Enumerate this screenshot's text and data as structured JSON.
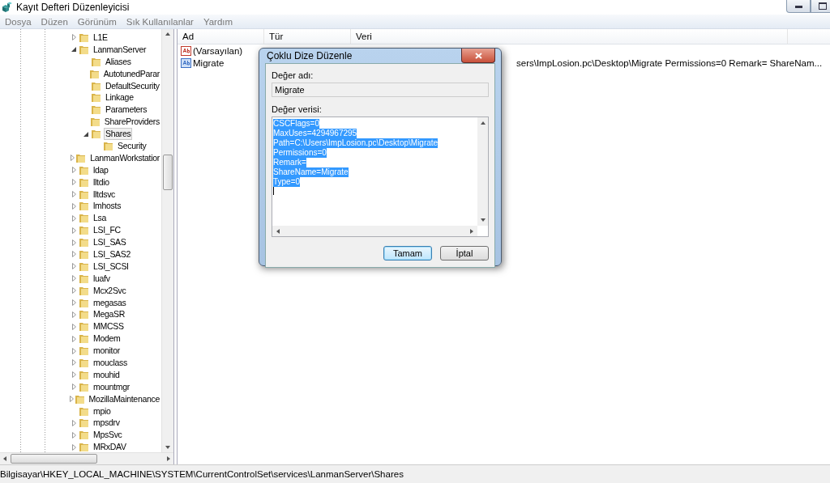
{
  "window": {
    "title": "Kayıt Defteri Düzenleyicisi"
  },
  "menu": [
    "Dosya",
    "Düzen",
    "Görünüm",
    "Sık Kullanılanlar",
    "Yardım"
  ],
  "tree": [
    {
      "label": "L1E",
      "kind": "branch",
      "expanded": false,
      "selected": false
    },
    {
      "label": "LanmanServer",
      "kind": "branch",
      "expanded": true,
      "selected": false,
      "children": [
        {
          "label": "Aliases",
          "kind": "leaf",
          "selected": false
        },
        {
          "label": "AutotunedParar",
          "kind": "leaf",
          "selected": false
        },
        {
          "label": "DefaultSecurity",
          "kind": "leaf",
          "selected": false
        },
        {
          "label": "Linkage",
          "kind": "leaf",
          "selected": false
        },
        {
          "label": "Parameters",
          "kind": "leaf",
          "selected": false
        },
        {
          "label": "ShareProviders",
          "kind": "leaf",
          "selected": false
        },
        {
          "label": "Shares",
          "kind": "branch",
          "expanded": true,
          "selected": true,
          "children": [
            {
              "label": "Security",
              "kind": "leaf",
              "selected": false
            }
          ]
        }
      ]
    },
    {
      "label": "LanmanWorkstatior",
      "kind": "branch",
      "expanded": false,
      "selected": false
    },
    {
      "label": "ldap",
      "kind": "branch",
      "expanded": false,
      "selected": false
    },
    {
      "label": "lltdio",
      "kind": "branch",
      "expanded": false,
      "selected": false
    },
    {
      "label": "lltdsvc",
      "kind": "branch",
      "expanded": false,
      "selected": false
    },
    {
      "label": "lmhosts",
      "kind": "branch",
      "expanded": false,
      "selected": false
    },
    {
      "label": "Lsa",
      "kind": "branch",
      "expanded": false,
      "selected": false
    },
    {
      "label": "LSI_FC",
      "kind": "branch",
      "expanded": false,
      "selected": false
    },
    {
      "label": "LSI_SAS",
      "kind": "branch",
      "expanded": false,
      "selected": false
    },
    {
      "label": "LSI_SAS2",
      "kind": "branch",
      "expanded": false,
      "selected": false
    },
    {
      "label": "LSI_SCSI",
      "kind": "branch",
      "expanded": false,
      "selected": false
    },
    {
      "label": "luafv",
      "kind": "branch",
      "expanded": false,
      "selected": false
    },
    {
      "label": "Mcx2Svc",
      "kind": "branch",
      "expanded": false,
      "selected": false
    },
    {
      "label": "megasas",
      "kind": "branch",
      "expanded": false,
      "selected": false
    },
    {
      "label": "MegaSR",
      "kind": "branch",
      "expanded": false,
      "selected": false
    },
    {
      "label": "MMCSS",
      "kind": "branch",
      "expanded": false,
      "selected": false
    },
    {
      "label": "Modem",
      "kind": "branch",
      "expanded": false,
      "selected": false
    },
    {
      "label": "monitor",
      "kind": "branch",
      "expanded": false,
      "selected": false
    },
    {
      "label": "mouclass",
      "kind": "branch",
      "expanded": false,
      "selected": false
    },
    {
      "label": "mouhid",
      "kind": "branch",
      "expanded": false,
      "selected": false
    },
    {
      "label": "mountmgr",
      "kind": "branch",
      "expanded": false,
      "selected": false
    },
    {
      "label": "MozillaMaintenance",
      "kind": "branch",
      "expanded": false,
      "selected": false
    },
    {
      "label": "mpio",
      "kind": "leaf",
      "selected": false
    },
    {
      "label": "mpsdrv",
      "kind": "branch",
      "expanded": false,
      "selected": false
    },
    {
      "label": "MpsSvc",
      "kind": "branch",
      "expanded": false,
      "selected": false
    },
    {
      "label": "MRxDAV",
      "kind": "branch",
      "expanded": false,
      "selected": false
    }
  ],
  "table": {
    "columns": [
      "Ad",
      "Tür",
      "Veri"
    ],
    "rows": [
      {
        "name": "(Varsayılan)",
        "kind": "default"
      },
      {
        "name": "Migrate",
        "kind": "multi",
        "data": "sers\\ImpLosion.pc\\Desktop\\Migrate Permissions=0 Remark= ShareNam..."
      }
    ]
  },
  "dialog": {
    "title": "Çoklu Dize Düzenle",
    "name_label": "Değer adı:",
    "name_value": "Migrate",
    "data_label": "Değer verisi:",
    "data_lines": [
      "CSCFlags=0",
      "MaxUses=4294967295",
      "Path=C:\\Users\\ImpLosion.pc\\Desktop\\Migrate",
      "Permissions=0",
      "Remark=",
      "ShareName=Migrate",
      "Type=0"
    ],
    "buttons": [
      {
        "label": "Tamam",
        "default": true
      },
      {
        "label": "İptal",
        "default": false
      }
    ]
  },
  "status_bar": "Bilgisayar\\HKEY_LOCAL_MACHINE\\SYSTEM\\CurrentControlSet\\services\\LanmanServer\\Shares"
}
